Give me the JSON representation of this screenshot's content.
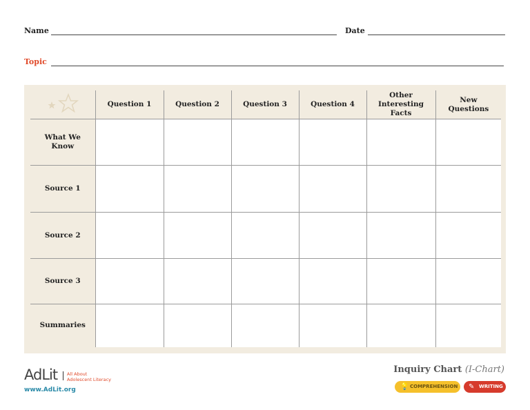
{
  "header": {
    "name_label": "Name",
    "date_label": "Date",
    "topic_label": "Topic"
  },
  "table": {
    "columns": [
      "Question 1",
      "Question 2",
      "Question 3",
      "Question 4",
      "Other Interesting Facts",
      "New Questions"
    ],
    "rows": [
      "What We Know",
      "Source 1",
      "Source 2",
      "Source 3",
      "Summaries"
    ]
  },
  "footer": {
    "logo_text": "AdLit",
    "tagline_1": "All About",
    "tagline_2": "Adolescent Literacy",
    "url": "www.AdLit.org",
    "title": "Inquiry Chart",
    "subtitle": "(I-Chart)",
    "badge_1": "COMPREHENSION",
    "badge_2": "WRITING"
  },
  "colors": {
    "accent": "#e04a2a",
    "panel": "#f2ece0",
    "badge_yellow": "#f5c02b",
    "badge_red": "#d63b2c",
    "link": "#2a8aa8"
  }
}
